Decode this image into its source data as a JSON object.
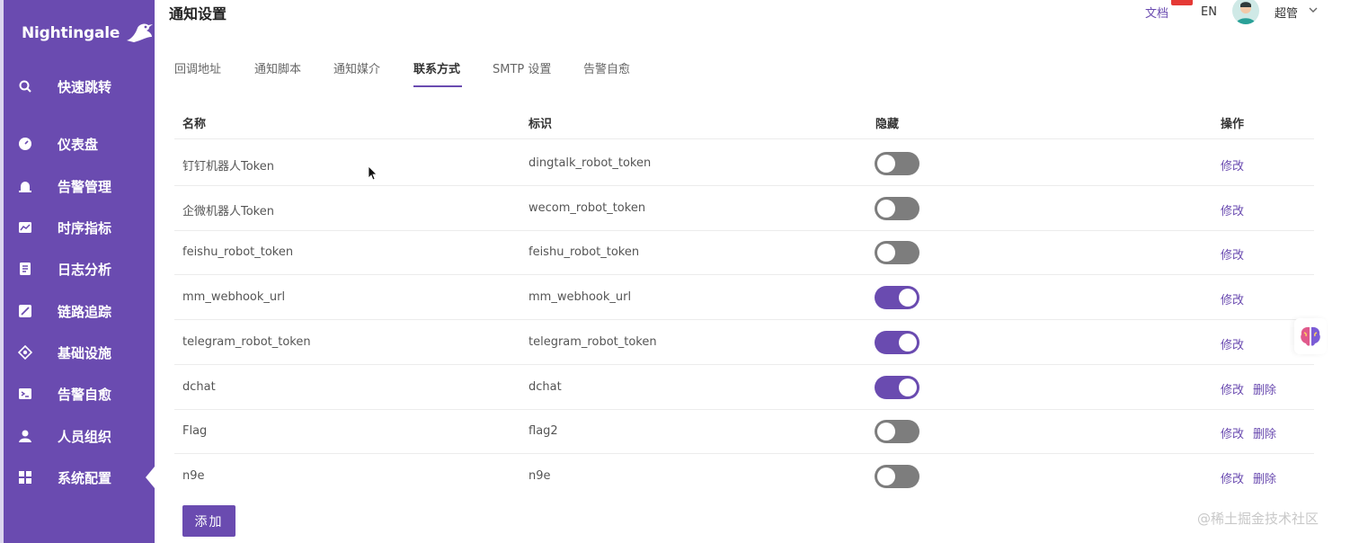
{
  "brand": {
    "logo_text": "Nightingale",
    "accent": "#6a4bb0"
  },
  "sidebar": {
    "items": [
      {
        "label": "快速跳转",
        "icon": "search-icon"
      },
      {
        "label": "仪表盘",
        "icon": "dashboard-icon"
      },
      {
        "label": "告警管理",
        "icon": "alarm-icon"
      },
      {
        "label": "时序指标",
        "icon": "metrics-icon"
      },
      {
        "label": "日志分析",
        "icon": "log-icon"
      },
      {
        "label": "链路追踪",
        "icon": "trace-icon"
      },
      {
        "label": "基础设施",
        "icon": "infra-icon"
      },
      {
        "label": "告警自愈",
        "icon": "terminal-icon"
      },
      {
        "label": "人员组织",
        "icon": "user-icon"
      },
      {
        "label": "系统配置",
        "icon": "grid-icon",
        "active": true
      }
    ]
  },
  "header": {
    "title": "通知设置",
    "docs_label": "文档",
    "lang_label": "EN",
    "user_label": "超管"
  },
  "tabs": [
    {
      "label": "回调地址"
    },
    {
      "label": "通知脚本"
    },
    {
      "label": "通知媒介"
    },
    {
      "label": "联系方式",
      "active": true
    },
    {
      "label": "SMTP 设置"
    },
    {
      "label": "告警自愈"
    }
  ],
  "table": {
    "columns": [
      "名称",
      "标识",
      "隐藏",
      "操作"
    ],
    "rows": [
      {
        "name": "钉钉机器人Token",
        "ident": "dingtalk_robot_token",
        "hidden": false,
        "actions": [
          "修改"
        ]
      },
      {
        "name": "企微机器人Token",
        "ident": "wecom_robot_token",
        "hidden": false,
        "actions": [
          "修改"
        ]
      },
      {
        "name": "feishu_robot_token",
        "ident": "feishu_robot_token",
        "hidden": false,
        "actions": [
          "修改"
        ]
      },
      {
        "name": "mm_webhook_url",
        "ident": "mm_webhook_url",
        "hidden": true,
        "actions": [
          "修改"
        ]
      },
      {
        "name": "telegram_robot_token",
        "ident": "telegram_robot_token",
        "hidden": true,
        "actions": [
          "修改"
        ]
      },
      {
        "name": "dchat",
        "ident": "dchat",
        "hidden": true,
        "actions": [
          "修改",
          "删除"
        ]
      },
      {
        "name": "Flag",
        "ident": "flag2",
        "hidden": false,
        "actions": [
          "修改",
          "删除"
        ]
      },
      {
        "name": "n9e",
        "ident": "n9e",
        "hidden": false,
        "actions": [
          "修改",
          "删除"
        ]
      }
    ]
  },
  "add_button_label": "添加",
  "watermark": "@稀土掘金技术社区"
}
